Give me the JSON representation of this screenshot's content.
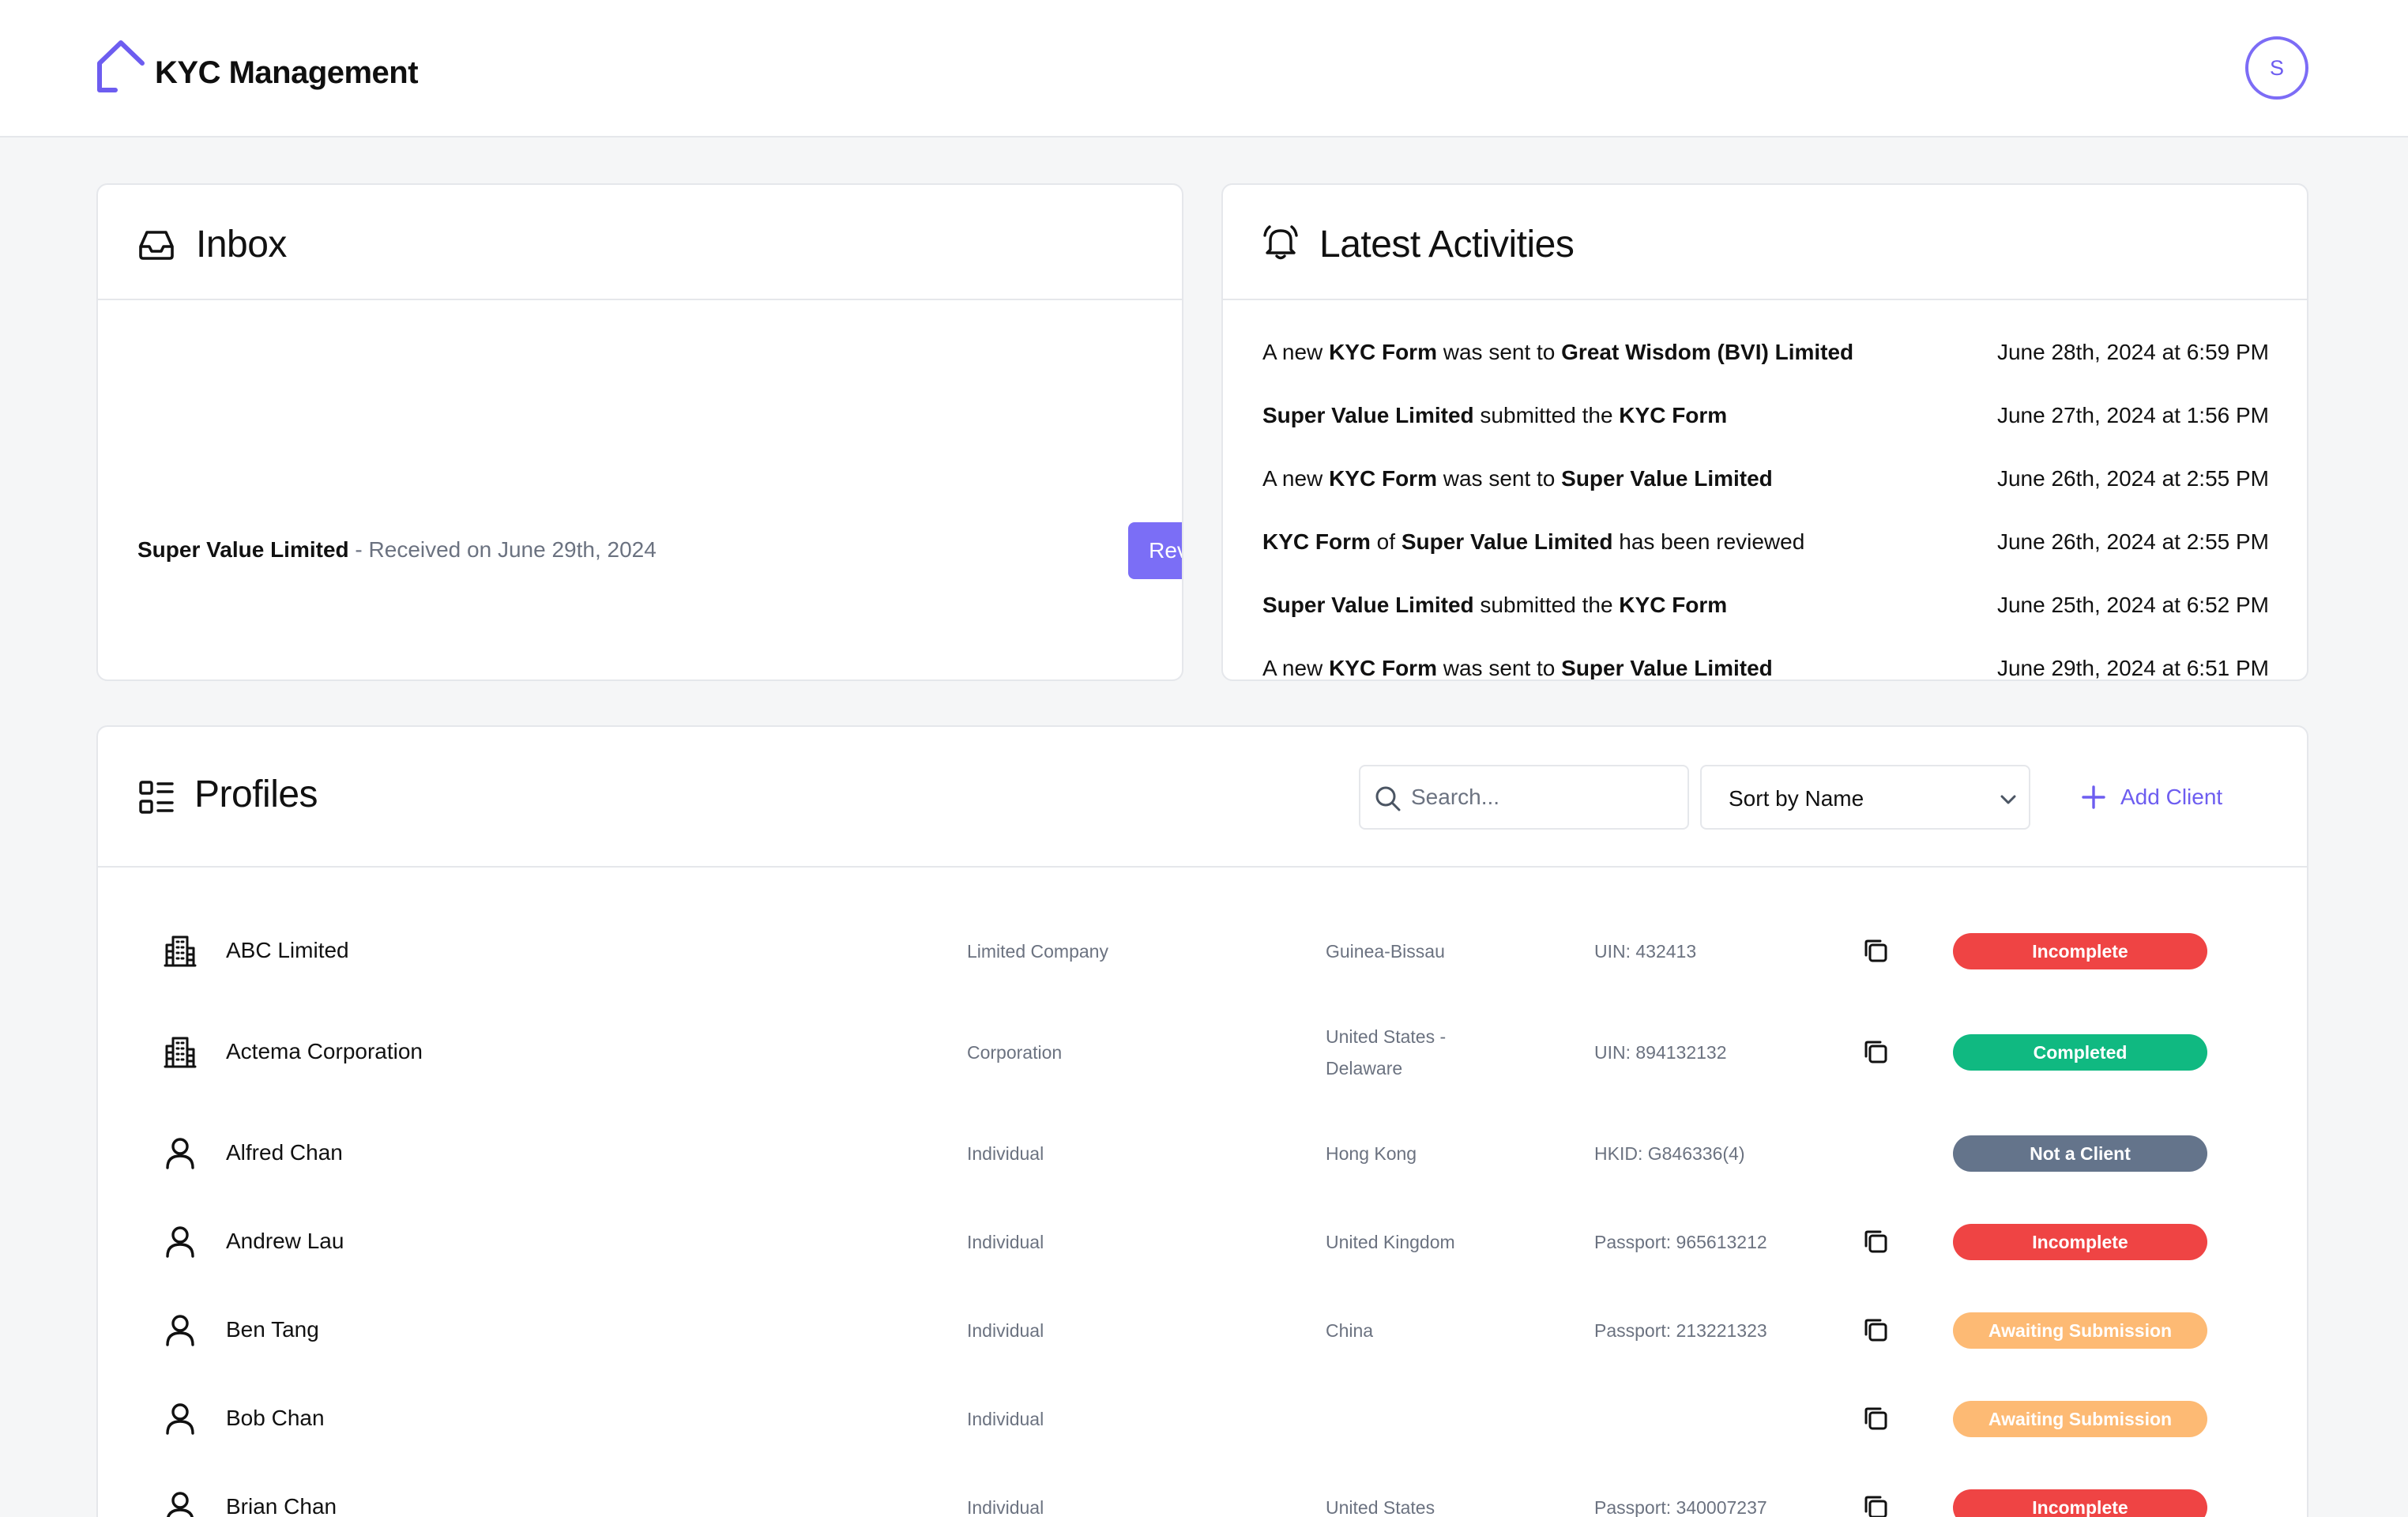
{
  "header": {
    "app_title": "KYC Management",
    "avatar_initial": "S"
  },
  "colors": {
    "accent": "#7b6ef6",
    "incomplete": "#ef4444",
    "completed": "#10b981",
    "not_a_client": "#64748b",
    "awaiting": "#fdba74"
  },
  "inbox": {
    "title": "Inbox",
    "item": {
      "name": "Super Value Limited",
      "meta": " - Received on June 29th, 2024",
      "button": "Review"
    }
  },
  "activities": {
    "title": "Latest Activities",
    "items": [
      {
        "parts": [
          [
            "A new ",
            false
          ],
          [
            "KYC Form",
            true
          ],
          [
            " was sent to ",
            false
          ],
          [
            "Great Wisdom (BVI) Limited",
            true
          ]
        ],
        "date": "June 28th, 2024 at 6:59 PM"
      },
      {
        "parts": [
          [
            "Super Value Limited",
            true
          ],
          [
            " submitted the ",
            false
          ],
          [
            "KYC Form",
            true
          ]
        ],
        "date": "June 27th, 2024 at 1:56 PM"
      },
      {
        "parts": [
          [
            "A new ",
            false
          ],
          [
            "KYC Form",
            true
          ],
          [
            " was sent to ",
            false
          ],
          [
            "Super Value Limited",
            true
          ]
        ],
        "date": "June 26th, 2024 at 2:55 PM"
      },
      {
        "parts": [
          [
            "KYC Form",
            true
          ],
          [
            " of ",
            false
          ],
          [
            "Super Value Limited",
            true
          ],
          [
            " has been reviewed",
            false
          ]
        ],
        "date": "June 26th, 2024 at 2:55 PM"
      },
      {
        "parts": [
          [
            "Super Value Limited",
            true
          ],
          [
            " submitted the ",
            false
          ],
          [
            "KYC Form",
            true
          ]
        ],
        "date": "June 25th, 2024 at 6:52 PM"
      },
      {
        "parts": [
          [
            "A new ",
            false
          ],
          [
            "KYC Form",
            true
          ],
          [
            " was sent to ",
            false
          ],
          [
            "Super Value Limited",
            true
          ]
        ],
        "date": "June 29th, 2024 at 6:51 PM"
      }
    ]
  },
  "profiles": {
    "title": "Profiles",
    "search_placeholder": "Search...",
    "sort_label": "Sort by Name",
    "add_client_label": "Add Client",
    "rows": [
      {
        "icon": "building-icon",
        "name": "ABC Limited",
        "type": "Limited Company",
        "country": [
          "Guinea-Bissau"
        ],
        "id": "UIN: 432413",
        "copy": true,
        "status": "Incomplete",
        "status_key": "incomplete"
      },
      {
        "icon": "building-icon",
        "name": "Actema Corporation",
        "type": "Corporation",
        "country": [
          "United States -",
          "Delaware"
        ],
        "id": "UIN: 894132132",
        "copy": true,
        "status": "Completed",
        "status_key": "completed"
      },
      {
        "icon": "user-icon",
        "name": "Alfred Chan",
        "type": "Individual",
        "country": [
          "Hong Kong"
        ],
        "id": "HKID: G846336(4)",
        "copy": false,
        "status": "Not a Client",
        "status_key": "not_a_client"
      },
      {
        "icon": "user-icon",
        "name": "Andrew Lau",
        "type": "Individual",
        "country": [
          "United Kingdom"
        ],
        "id": "Passport: 965613212",
        "copy": true,
        "status": "Incomplete",
        "status_key": "incomplete"
      },
      {
        "icon": "user-icon",
        "name": "Ben Tang",
        "type": "Individual",
        "country": [
          "China"
        ],
        "id": "Passport: 213221323",
        "copy": true,
        "status": "Awaiting Submission",
        "status_key": "awaiting"
      },
      {
        "icon": "user-icon",
        "name": "Bob Chan",
        "type": "Individual",
        "country": [
          ""
        ],
        "id": "",
        "copy": true,
        "status": "Awaiting Submission",
        "status_key": "awaiting"
      },
      {
        "icon": "user-icon",
        "name": "Brian Chan",
        "type": "Individual",
        "country": [
          "United States"
        ],
        "id": "Passport: 340007237",
        "copy": true,
        "status": "Incomplete",
        "status_key": "incomplete"
      }
    ]
  }
}
